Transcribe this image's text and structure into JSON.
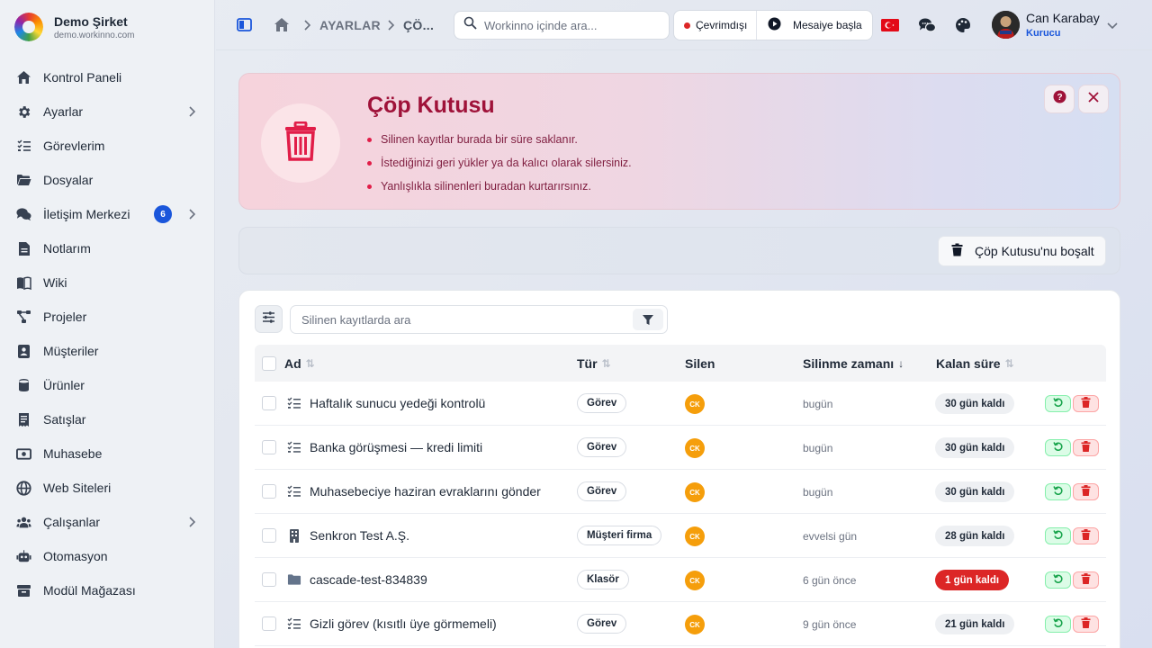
{
  "brand": {
    "name": "Demo Şirket",
    "domain": "demo.workinno.com"
  },
  "sidebar": {
    "items": [
      {
        "label": "Kontrol Paneli",
        "icon": "home-icon"
      },
      {
        "label": "Ayarlar",
        "icon": "gear-icon",
        "has_submenu": true
      },
      {
        "label": "Görevlerim",
        "icon": "task-list-icon"
      },
      {
        "label": "Dosyalar",
        "icon": "folder-open-icon"
      },
      {
        "label": "İletişim Merkezi",
        "icon": "chat-icon",
        "badge": "6",
        "has_submenu": true
      },
      {
        "label": "Notlarım",
        "icon": "note-icon"
      },
      {
        "label": "Wiki",
        "icon": "book-icon"
      },
      {
        "label": "Projeler",
        "icon": "project-icon"
      },
      {
        "label": "Müşteriler",
        "icon": "contact-book-icon"
      },
      {
        "label": "Ürünler",
        "icon": "product-icon"
      },
      {
        "label": "Satışlar",
        "icon": "receipt-icon"
      },
      {
        "label": "Muhasebe",
        "icon": "money-icon"
      },
      {
        "label": "Web Siteleri",
        "icon": "globe-icon"
      },
      {
        "label": "Çalışanlar",
        "icon": "users-icon",
        "has_submenu": true
      },
      {
        "label": "Otomasyon",
        "icon": "robot-icon"
      },
      {
        "label": "Modül Mağazası",
        "icon": "store-icon"
      }
    ]
  },
  "topbar": {
    "breadcrumb": [
      "AYARLAR",
      "ÇÖ..."
    ],
    "search_placeholder": "Workinno içinde ara...",
    "status_label": "Çevrimdışı",
    "shift_label": "Mesaiye başla",
    "user_name": "Can Karabay",
    "user_role": "Kurucu"
  },
  "hero": {
    "title": "Çöp Kutusu",
    "bullets": [
      "Silinen kayıtlar burada bir süre saklanır.",
      "İstediğinizi geri yükler ya da kalıcı olarak silersiniz.",
      "Yanlışlıkla silinenleri buradan kurtarırsınız."
    ]
  },
  "actions": {
    "empty_label": "Çöp Kutusu'nu boşalt"
  },
  "table": {
    "search_placeholder": "Silinen kayıtlarda ara",
    "columns": {
      "name": "Ad",
      "type": "Tür",
      "deleted_by": "Silen",
      "deleted_at": "Silinme zamanı",
      "remaining": "Kalan süre"
    },
    "rows": [
      {
        "name": "Haftalık sunucu yedeği kontrolü",
        "type": "Görev",
        "icon": "task-list-icon",
        "deleted_by": "CK",
        "deleted_at": "bugün",
        "remaining": "30 gün kaldı",
        "urgent": false
      },
      {
        "name": "Banka görüşmesi — kredi limiti",
        "type": "Görev",
        "icon": "task-list-icon",
        "deleted_by": "CK",
        "deleted_at": "bugün",
        "remaining": "30 gün kaldı",
        "urgent": false
      },
      {
        "name": "Muhasebeciye haziran evraklarını gönder",
        "type": "Görev",
        "icon": "task-list-icon",
        "deleted_by": "CK",
        "deleted_at": "bugün",
        "remaining": "30 gün kaldı",
        "urgent": false
      },
      {
        "name": "Senkron Test A.Ş.",
        "type": "Müşteri firma",
        "icon": "building-icon",
        "deleted_by": "CK",
        "deleted_at": "evvelsi gün",
        "remaining": "28 gün kaldı",
        "urgent": false
      },
      {
        "name": "cascade-test-834839",
        "type": "Klasör",
        "icon": "folder-icon",
        "deleted_by": "CK",
        "deleted_at": "6 gün önce",
        "remaining": "1 gün kaldı",
        "urgent": true
      },
      {
        "name": "Gizli görev (kısıtlı üye görmemeli)",
        "type": "Görev",
        "icon": "task-list-icon",
        "deleted_by": "CK",
        "deleted_at": "9 gün önce",
        "remaining": "21 gün kaldı",
        "urgent": false
      }
    ]
  },
  "colors": {
    "accent": "#1a56db",
    "danger": "#dc2626",
    "hero_title": "#9f1239",
    "avatar": "#f59e0b",
    "restore": "#16a34a"
  }
}
